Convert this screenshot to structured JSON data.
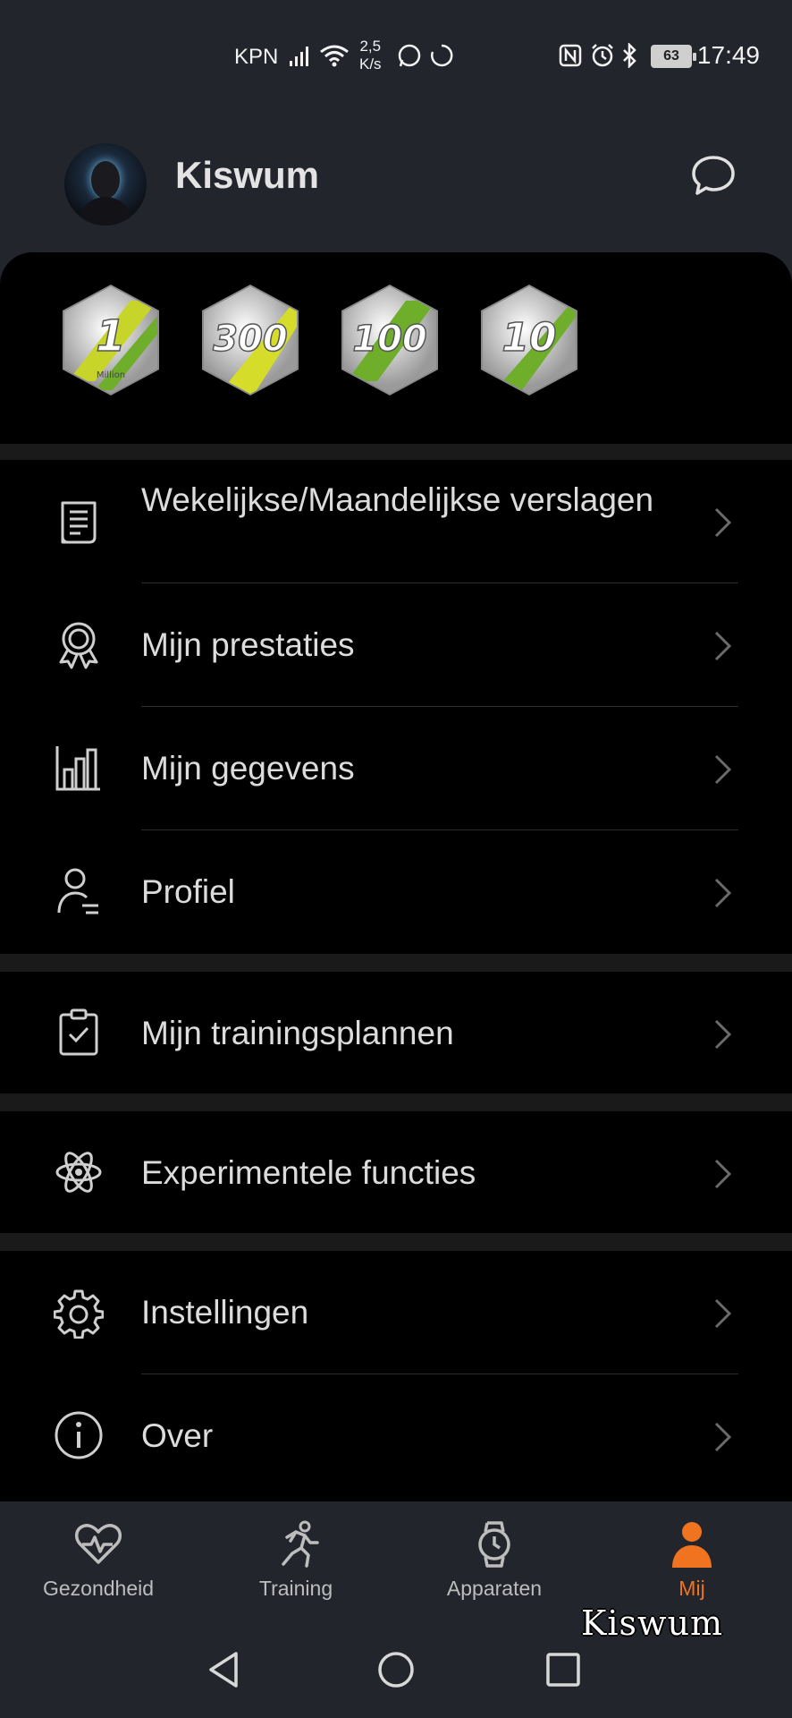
{
  "status_bar": {
    "carrier": "KPN",
    "speed_value": "2,5",
    "speed_unit": "K/s",
    "battery": "63",
    "time": "17:49"
  },
  "header": {
    "username": "Kiswum"
  },
  "badges": [
    {
      "number": "1",
      "subtitle": "Million",
      "stripe_color": "#c7d42a"
    },
    {
      "number": "300",
      "subtitle": "",
      "stripe_color": "#d6dc2a"
    },
    {
      "number": "100",
      "subtitle": "",
      "stripe_color": "#6fae2a"
    },
    {
      "number": "10",
      "subtitle": "",
      "stripe_color": "#6fae2a"
    }
  ],
  "menu": {
    "reports": "Wekelijkse/Maandelijkse verslagen",
    "achievements": "Mijn prestaties",
    "data": "Mijn gegevens",
    "profile": "Profiel",
    "training_plans": "Mijn trainingsplannen",
    "experimental": "Experimentele functies",
    "settings": "Instellingen",
    "about": "Over"
  },
  "tabs": {
    "health": "Gezondheid",
    "training": "Training",
    "devices": "Apparaten",
    "me": "Mij"
  },
  "watermark": "Kiswum",
  "colors": {
    "accent": "#f0731f",
    "background": "#000000",
    "bar": "#23252c"
  }
}
